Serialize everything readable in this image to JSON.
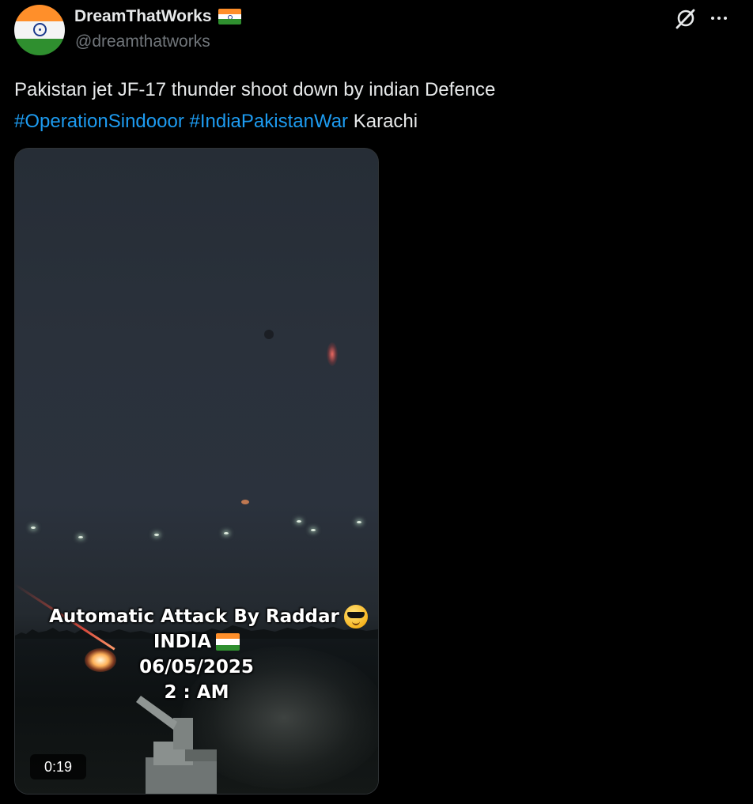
{
  "author": {
    "display_name": "DreamThatWorks",
    "handle": "@dreamthatworks",
    "badge_icon": "india-flag-icon"
  },
  "header_actions": {
    "grok_icon": "grok-icon",
    "more_icon": "more-horizontal-icon"
  },
  "tweet": {
    "text_line1": "Pakistan jet JF-17 thunder shoot down by indian Defence",
    "hashtag1": "#OperationSindooor",
    "hashtag2": "#IndiaPakistanWar",
    "trailing_text": "Karachi"
  },
  "media": {
    "type": "video",
    "duration": "0:19",
    "overlay": {
      "line1": "Automatic Attack  By Raddar",
      "line1_emoji": "smiling-face-with-sunglasses-icon",
      "line2": "INDIA",
      "line2_emoji": "india-flag-icon",
      "line3": "06/05/2025",
      "line4": "2 : AM"
    }
  },
  "colors": {
    "background": "#000000",
    "text_primary": "#e7e9ea",
    "text_secondary": "#71767b",
    "link": "#1d9bf0"
  }
}
